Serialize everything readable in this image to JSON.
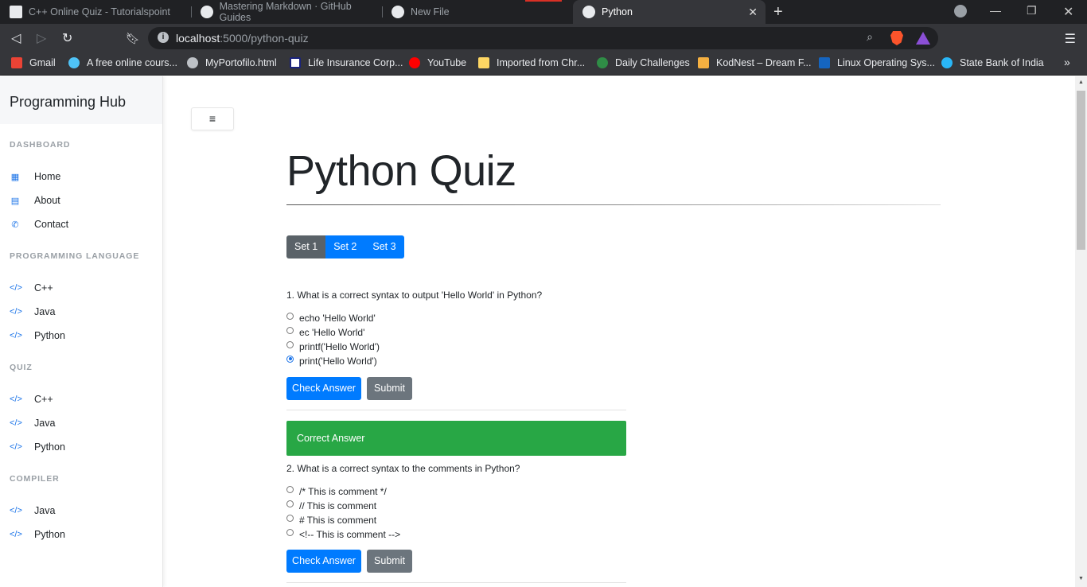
{
  "browser": {
    "tabs": [
      {
        "title": "C++ Online Quiz - Tutorialspoint",
        "active": false
      },
      {
        "title": "Mastering Markdown · GitHub Guides",
        "active": false
      },
      {
        "title": "New File",
        "active": false
      },
      {
        "title": "Python",
        "active": true
      }
    ],
    "url_host": "localhost",
    "url_path": ":5000/python-quiz",
    "bookmarks": [
      "Gmail",
      "A free online cours...",
      "MyPortofilo.html",
      "Life Insurance Corp...",
      "YouTube",
      "Imported from Chr...",
      "Daily Challenges",
      "KodNest – Dream F...",
      "Linux Operating Sys...",
      "State Bank of India"
    ],
    "more_bookmarks": "»"
  },
  "sidebar": {
    "brand": "Programming Hub",
    "sections": [
      {
        "title": "DASHBOARD",
        "items": [
          {
            "label": "Home",
            "icon": "grid-icon"
          },
          {
            "label": "About",
            "icon": "id-card-icon"
          },
          {
            "label": "Contact",
            "icon": "phone-icon"
          }
        ]
      },
      {
        "title": "PROGRAMMING LANGUAGE",
        "items": [
          {
            "label": "C++",
            "icon": "code-icon"
          },
          {
            "label": "Java",
            "icon": "code-icon"
          },
          {
            "label": "Python",
            "icon": "code-icon"
          }
        ]
      },
      {
        "title": "QUIZ",
        "items": [
          {
            "label": "C++",
            "icon": "code-icon"
          },
          {
            "label": "Java",
            "icon": "code-icon"
          },
          {
            "label": "Python",
            "icon": "code-icon"
          }
        ]
      },
      {
        "title": "COMPILER",
        "items": [
          {
            "label": "Java",
            "icon": "code-icon"
          },
          {
            "label": "Python",
            "icon": "code-icon"
          }
        ]
      }
    ]
  },
  "main": {
    "title": "Python Quiz",
    "sets": [
      {
        "label": "Set 1",
        "active": true
      },
      {
        "label": "Set 2",
        "active": false
      },
      {
        "label": "Set 3",
        "active": false
      }
    ],
    "questions": [
      {
        "text": "1. What is a correct syntax to output 'Hello World' in Python?",
        "options": [
          "echo 'Hello World'",
          "ec 'Hello World'",
          "printf('Hello World')",
          "print('Hello World')"
        ],
        "selected": 3
      },
      {
        "text": "2. What is a correct syntax to the comments in Python?",
        "options": [
          "/* This is comment */",
          "// This is comment",
          "# This is comment",
          "<!-- This is comment -->"
        ],
        "selected": null
      }
    ],
    "check_label": "Check Answer",
    "submit_label": "Submit",
    "alert": "Correct Answer"
  },
  "colors": {
    "primary": "#007bff",
    "secondary": "#6c757d",
    "success": "#28a745",
    "active_set": "#5a6268"
  }
}
